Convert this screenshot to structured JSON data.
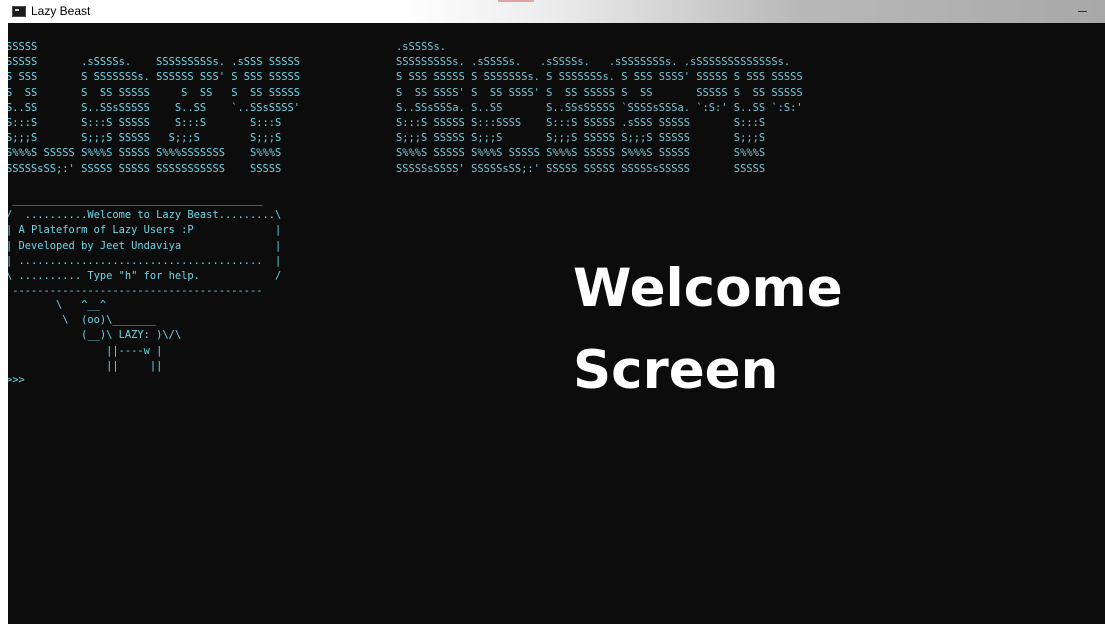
{
  "window": {
    "title": "Lazy Beast",
    "app_icon": "console-app-icon",
    "minimize_icon": "minimize-icon"
  },
  "console": {
    "banner_left": "SSSSS\nSSSSS       .sSSSSs.    SSSSSSSSSs. .sSSS SSSSS\nS SSS       S SSSSSSSs. SSSSSS SSS' S SSS SSSSS\nS  SS       S  SS SSSSS     S  SS   S  SS SSSSS\nS..SS       S..SSsSSSSS    S..SS    `..SSsSSSS'\nS:::S       S:::S SSSSS    S:::S       S:::S\nS;;;S       S;;;S SSSSS   S;;;S        S;;;S\nS%%%S SSSSS S%%%S SSSSS S%%%SSSSSSS    S%%%S\nSSSSSsSS;:' SSSSS SSSSS SSSSSSSSSSS    SSSSS",
    "banner_right": ".sSSSSs.\nSSSSSSSSSs. .sSSSSs.   .sSSSSs.   .sSSSSSSSs. .sSSSSSSSSSSSSSs.\nS SSS SSSSS S SSSSSSSs. S SSSSSSSs. S SSS SSSS' SSSSS S SSS SSSSS\nS  SS SSSS' S  SS SSSS' S  SS SSSSS S  SS       SSSSS S  SS SSSSS\nS..SSsSSSa. S..SS       S..SSsSSSSS `SSSSsSSSa. `:S:' S..SS `:S:'\nS:::S SSSSS S:::SSSS    S:::S SSSSS .sSSS SSSSS       S:::S\nS;;;S SSSSS S;;;S       S;;;S SSSSS S;;;S SSSSS       S;;;S\nS%%%S SSSSS S%%%S SSSSS S%%%S SSSSS S%%%S SSSSS       S%%%S\nSSSSSsSSSS' SSSSSsSS;:' SSSSS SSSSS SSSSSsSSSSS       SSSSS",
    "message_box": " ________________________________________\n/  ..........Welcome to Lazy Beast.........\\\n| A Plateform of Lazy Users :P             |\n| Developed by Jeet Undaviya               |\n| .......................................  |\n\\ .......... Type \"h\" for help.            /\n ----------------------------------------",
    "cow": "        \\   ^__^\n         \\  (oo)\\_______\n            (__)\\ LAZY: )\\/\\\n                ||----w |\n                ||     ||",
    "prompt": ">>>"
  },
  "overlay": {
    "text": "Welcome\nScreen"
  },
  "colors": {
    "console_background": "#0c0c0c",
    "console_text": "#6fd6e8",
    "overlay_text": "#ffffff"
  }
}
